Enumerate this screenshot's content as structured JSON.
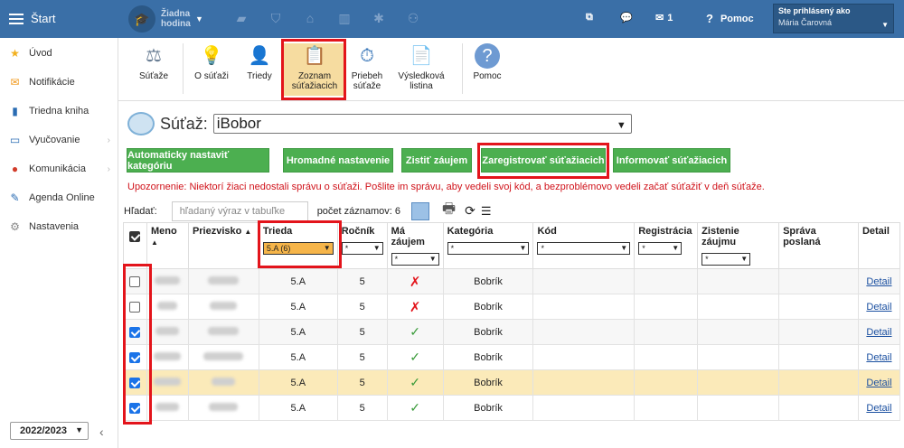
{
  "topbar": {
    "home_label": "Štart",
    "hour_label": "Žiadna hodina",
    "messages_count": "1",
    "help_label": "Pomoc",
    "user_title": "Ste prihlásený ako",
    "user_name": "Mária Čarovná"
  },
  "sidebar": {
    "items": [
      {
        "label": "Úvod",
        "icon": "star-icon"
      },
      {
        "label": "Notifikácie",
        "icon": "envelope-icon"
      },
      {
        "label": "Triedna kniha",
        "icon": "book-icon"
      },
      {
        "label": "Vyučovanie",
        "icon": "open-book-icon"
      },
      {
        "label": "Komunikácia",
        "icon": "chat-icon"
      },
      {
        "label": "Agenda Online",
        "icon": "pen-icon"
      },
      {
        "label": "Nastavenia",
        "icon": "gear-icon"
      }
    ],
    "year": "2022/2023"
  },
  "toolbar": {
    "items": [
      {
        "label": "Súťaže"
      },
      {
        "label": "O súťaži"
      },
      {
        "label": "Triedy"
      },
      {
        "label": "Zoznam súťažiacich"
      },
      {
        "label": "Priebeh súťaže"
      },
      {
        "label": "Výsledková listina"
      },
      {
        "label": "Pomoc"
      }
    ]
  },
  "main": {
    "title_label": "Súťaž:",
    "competition": "iBobor",
    "buttons": [
      "Automaticky nastaviť kategóriu",
      "Hromadné nastavenie",
      "Zistiť záujem",
      "Zaregistrovať súťažiacich",
      "Informovať súťažiacich"
    ],
    "warning": "Upozornenie: Niektorí žiaci nedostali správu o súťaži. Pošlite im správu, aby vedeli svoj kód, a bezproblémovo vedeli začať súťažiť v deň súťaže.",
    "search_label": "Hľadať:",
    "search_placeholder": "hľadaný výraz v tabuľke",
    "count_label": "počet záznamov: 6"
  },
  "table": {
    "headers": {
      "meno": "Meno",
      "priezvisko": "Priezvisko",
      "trieda": "Trieda",
      "rocnik": "Ročník",
      "zaujem": "Má záujem",
      "kategoria": "Kategória",
      "kod": "Kód",
      "registracia": "Registrácia",
      "zistenie": "Zistenie záujmu",
      "sprava": "Správa poslaná",
      "detail": "Detail"
    },
    "filters": {
      "trieda": "5.A (6)",
      "any": "*"
    },
    "rows": [
      {
        "trieda": "5.A",
        "rocnik": "5",
        "zaujem": "✗",
        "kategoria": "Bobrík",
        "detail": "Detail"
      },
      {
        "trieda": "5.A",
        "rocnik": "5",
        "zaujem": "✗",
        "kategoria": "Bobrík",
        "detail": "Detail"
      },
      {
        "trieda": "5.A",
        "rocnik": "5",
        "zaujem": "✓",
        "kategoria": "Bobrík",
        "detail": "Detail"
      },
      {
        "trieda": "5.A",
        "rocnik": "5",
        "zaujem": "✓",
        "kategoria": "Bobrík",
        "detail": "Detail"
      },
      {
        "trieda": "5.A",
        "rocnik": "5",
        "zaujem": "✓",
        "kategoria": "Bobrík",
        "detail": "Detail"
      },
      {
        "trieda": "5.A",
        "rocnik": "5",
        "zaujem": "✓",
        "kategoria": "Bobrík",
        "detail": "Detail"
      }
    ]
  }
}
